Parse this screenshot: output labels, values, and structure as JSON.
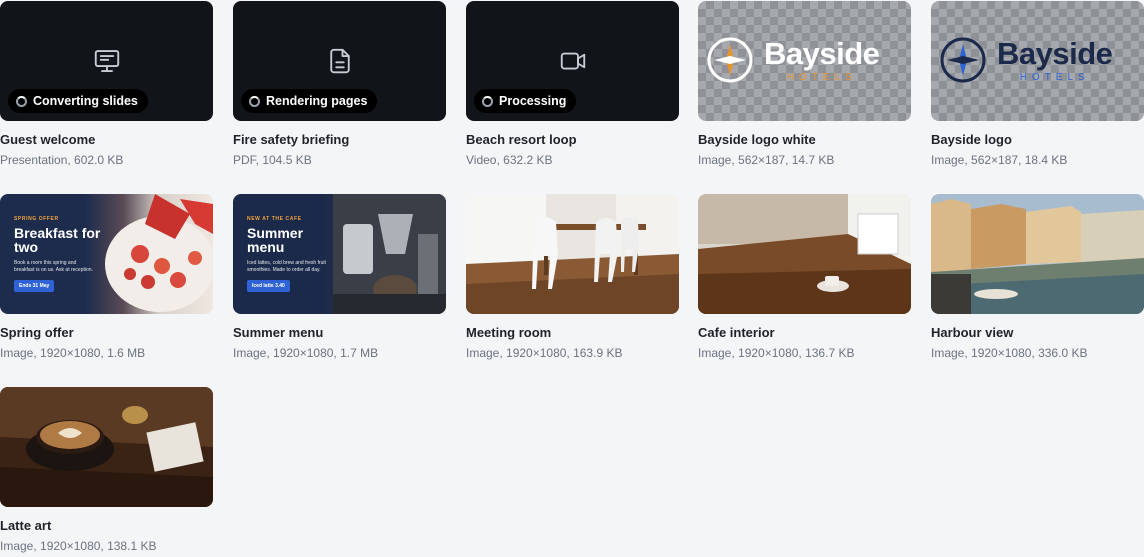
{
  "assets": [
    {
      "name": "Guest welcome",
      "meta": "Presentation, 602.0 KB",
      "icon": "monitor-icon",
      "status": "Converting slides"
    },
    {
      "name": "Fire safety briefing",
      "meta": "PDF, 104.5 KB",
      "icon": "document-icon",
      "status": "Rendering pages"
    },
    {
      "name": "Beach resort loop",
      "meta": "Video, 632.2 KB",
      "icon": "video-camera-icon",
      "status": "Processing"
    },
    {
      "name": "Bayside logo white",
      "meta": "Image, 562×187, 14.7 KB",
      "logo_word": "Bayside",
      "logo_sub": "HOTELS"
    },
    {
      "name": "Bayside logo",
      "meta": "Image, 562×187, 18.4 KB",
      "logo_word": "Bayside",
      "logo_sub": "HOTELS"
    },
    {
      "name": "Spring offer",
      "meta": "Image, 1920×1080, 1.6 MB",
      "promo": {
        "kicker": "SPRING OFFER",
        "headline_1": "Breakfast for",
        "headline_2": "two",
        "desc": "Book a room this spring and breakfast is on us. Ask at reception.",
        "cta": "Ends 31 May"
      }
    },
    {
      "name": "Summer menu",
      "meta": "Image, 1920×1080, 1.7 MB",
      "promo": {
        "kicker": "NEW AT THE CAFE",
        "headline_1": "Summer",
        "headline_2": "menu",
        "desc": "Iced lattes, cold brew and fresh fruit smoothies. Made to order all day.",
        "cta": "Iced latte 3.40"
      }
    },
    {
      "name": "Meeting room",
      "meta": "Image, 1920×1080, 163.9 KB"
    },
    {
      "name": "Cafe interior",
      "meta": "Image, 1920×1080, 136.7 KB"
    },
    {
      "name": "Harbour view",
      "meta": "Image, 1920×1080, 336.0 KB"
    },
    {
      "name": "Latte art",
      "meta": "Image, 1920×1080, 138.1 KB"
    }
  ],
  "colors": {
    "card_dark": "#111419",
    "brand_navy": "#1b2a4a",
    "brand_orange": "#e8952f",
    "cta_blue": "#2f62d6"
  }
}
